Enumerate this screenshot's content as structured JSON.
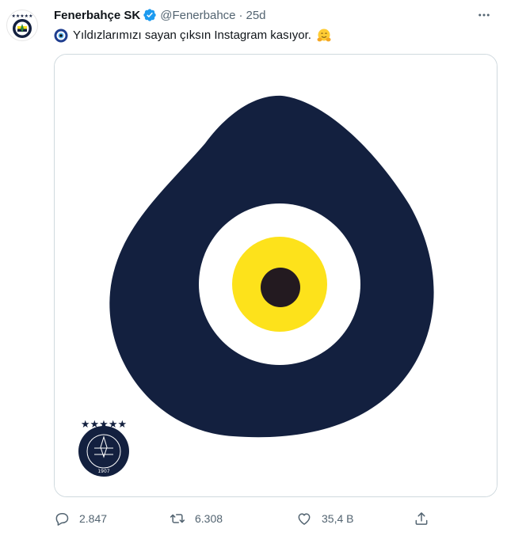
{
  "author": {
    "display_name": "Fenerbahçe SK",
    "handle": "@Fenerbahce",
    "separator": "·",
    "timestamp": "25d",
    "verified": true,
    "avatar_icon": "fenerbahce-crest"
  },
  "tweet": {
    "text": "Yıldızlarımızı sayan çıksın Instagram kasıyor.",
    "leading_emoji": "nazar-boncugu-icon",
    "trailing_emoji": "hugging-face-icon"
  },
  "media": {
    "description_icon": "evil-eye-icon",
    "colors": {
      "outer": "#13203f",
      "white": "#ffffff",
      "yellow": "#fde21b",
      "pupil": "#231a20"
    },
    "crest": {
      "ring_text": "FENERBAHÇE SPOR KULÜBÜ",
      "year": "1907",
      "stars": "★★★★★"
    }
  },
  "actions": {
    "replies": "2.847",
    "retweets": "6.308",
    "likes": "35,4 B"
  },
  "colors": {
    "verified_blue": "#1d9bf0",
    "muted_text": "#536471",
    "border": "#cfd9de"
  }
}
